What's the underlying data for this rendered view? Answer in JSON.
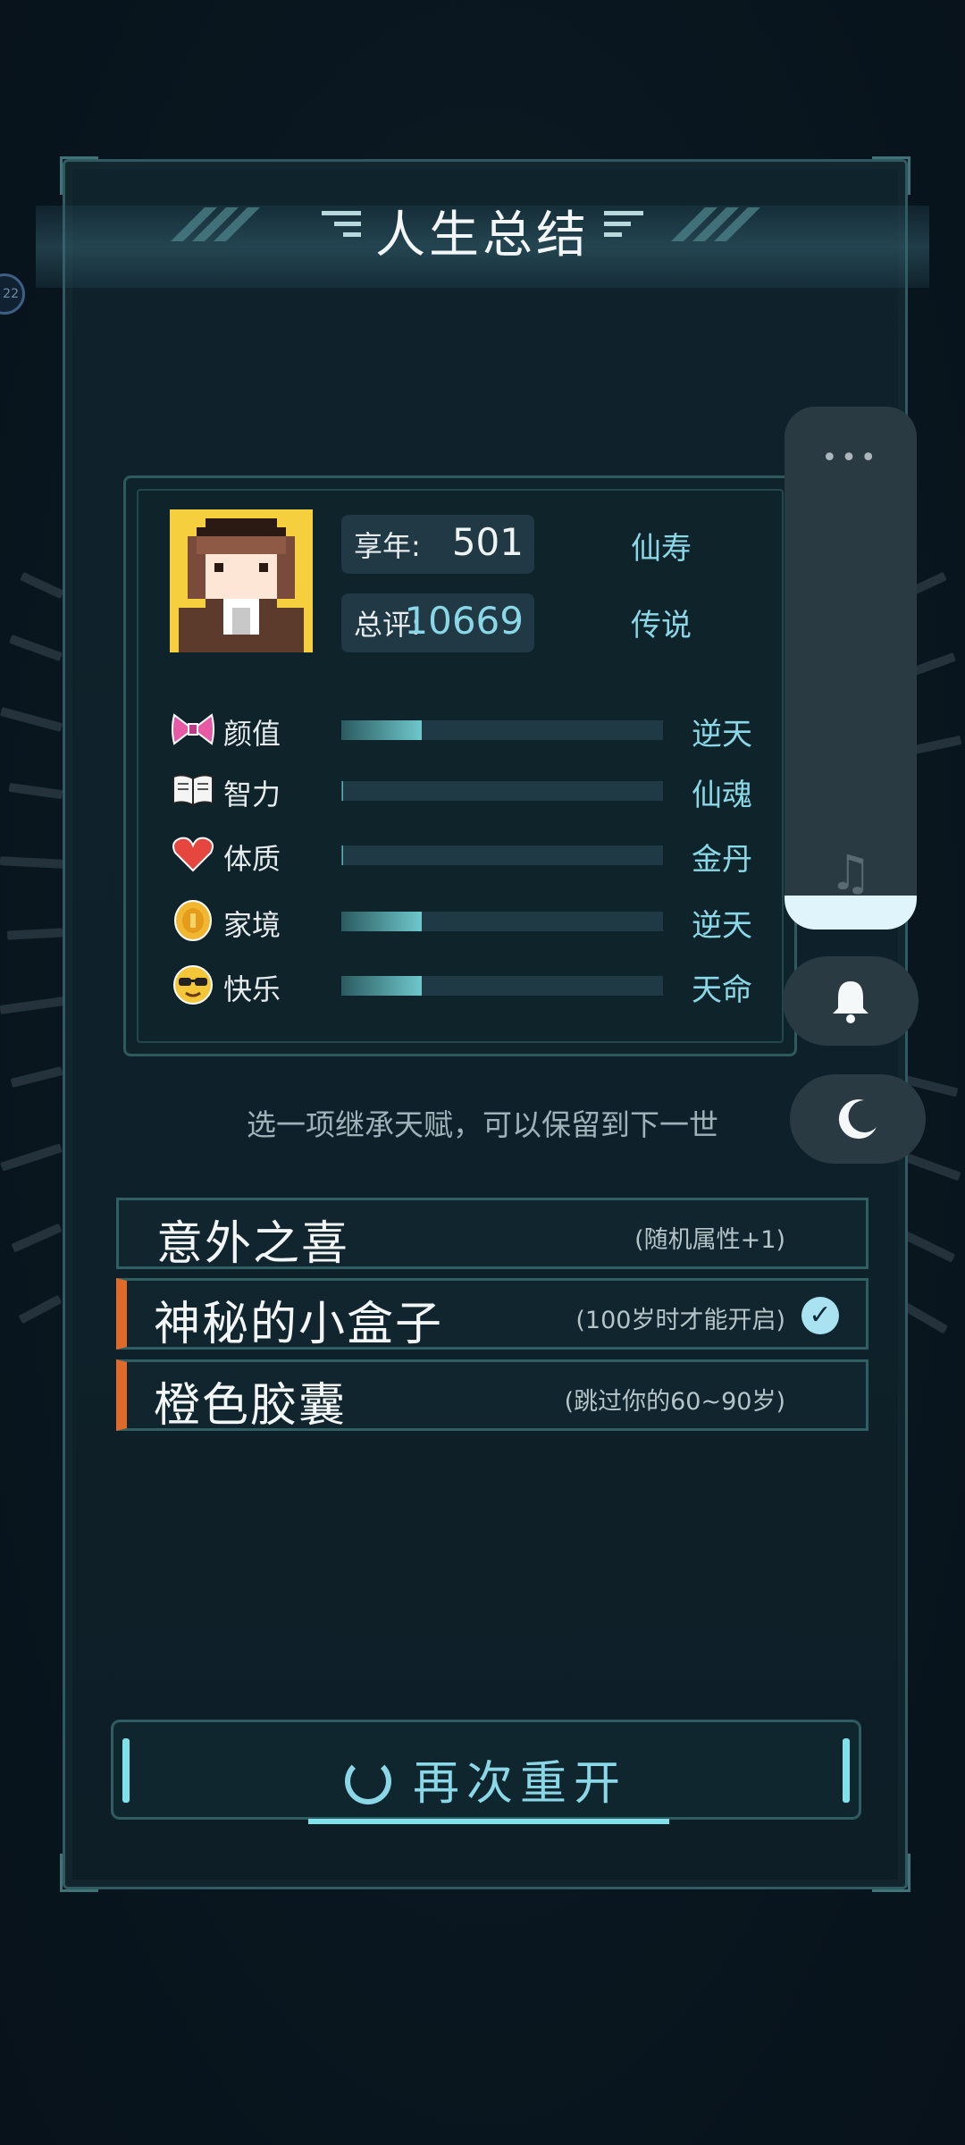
{
  "header": {
    "title": "人生总结"
  },
  "side_badge": "22",
  "profile": {
    "age_label": "享年:",
    "age_value": "501",
    "age_rank": "仙寿",
    "score_label": "总评:",
    "score_value": "10669",
    "score_rank": "传说"
  },
  "attributes": [
    {
      "name": "颜值",
      "rank": "逆天",
      "level": 0.25,
      "icon": "bow-icon"
    },
    {
      "name": "智力",
      "rank": "仙魂",
      "level": 0.0,
      "icon": "book-icon"
    },
    {
      "name": "体质",
      "rank": "金丹",
      "level": 0.0,
      "icon": "heart-icon"
    },
    {
      "name": "家境",
      "rank": "逆天",
      "level": 0.25,
      "icon": "coin-icon"
    },
    {
      "name": "快乐",
      "rank": "天命",
      "level": 0.25,
      "icon": "sunglasses-face-icon"
    }
  ],
  "inherit_hint": "选一项继承天赋，可以保留到下一世",
  "talents": [
    {
      "title": "意外之喜",
      "desc": "(随机属性+1)",
      "selected": false
    },
    {
      "title": "神秘的小盒子",
      "desc": "(100岁时才能开启)",
      "selected": true
    },
    {
      "title": "橙色胶囊",
      "desc": "(跳过你的60~90岁)",
      "selected": false
    }
  ],
  "restart": {
    "label": "再次重开"
  },
  "float_controls": {
    "more": "•••",
    "music_icon": "music-note-icon",
    "bell_icon": "bell-icon",
    "moon_icon": "moon-icon"
  },
  "colors": {
    "accent": "#8ad8e7",
    "orange_marker": "#e06a2a",
    "frame": "#2f5a60"
  }
}
